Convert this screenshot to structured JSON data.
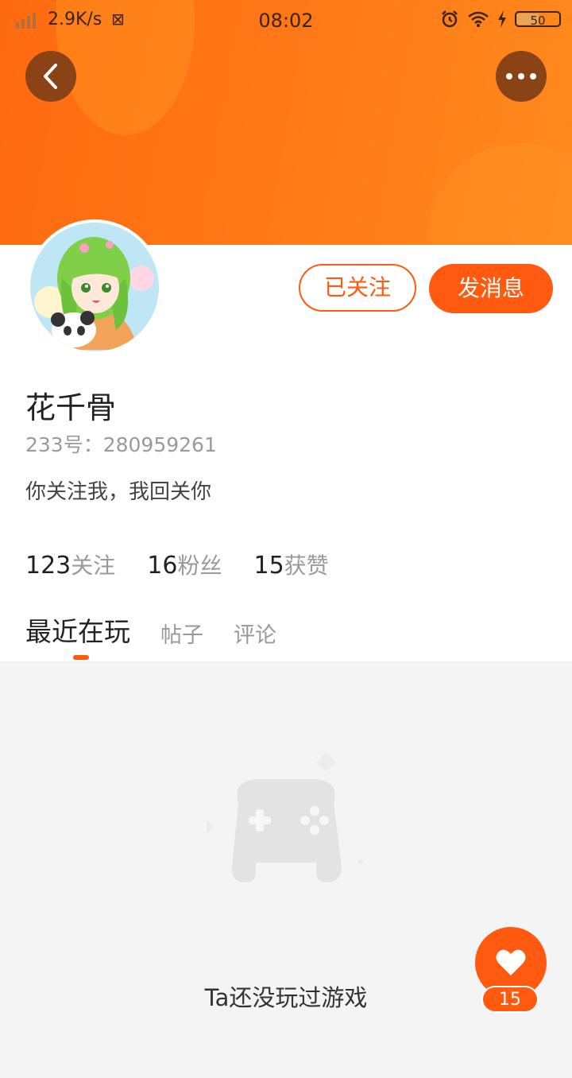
{
  "status_bar": {
    "network_speed": "2.9K/s",
    "time": "08:02",
    "battery": "50"
  },
  "header": {
    "back_icon": "chevron-left-icon",
    "more_icon": "more-dots-icon",
    "accent_color": "#ff6a10"
  },
  "profile": {
    "name": "花千骨",
    "id_label": "233号：280959261",
    "bio": "你关注我，我回关你",
    "follow_button": "已关注",
    "message_button": "发消息"
  },
  "stats": [
    {
      "value": "123",
      "label": "关注"
    },
    {
      "value": "16",
      "label": "粉丝"
    },
    {
      "value": "15",
      "label": "获赞"
    }
  ],
  "tabs": [
    {
      "label": "最近在玩",
      "active": true
    },
    {
      "label": "帖子",
      "active": false
    },
    {
      "label": "评论",
      "active": false
    }
  ],
  "empty_state": {
    "icon": "gamepad-icon",
    "text": "Ta还没玩过游戏"
  },
  "like_fab": {
    "icon": "heart-icon",
    "count": "15"
  }
}
